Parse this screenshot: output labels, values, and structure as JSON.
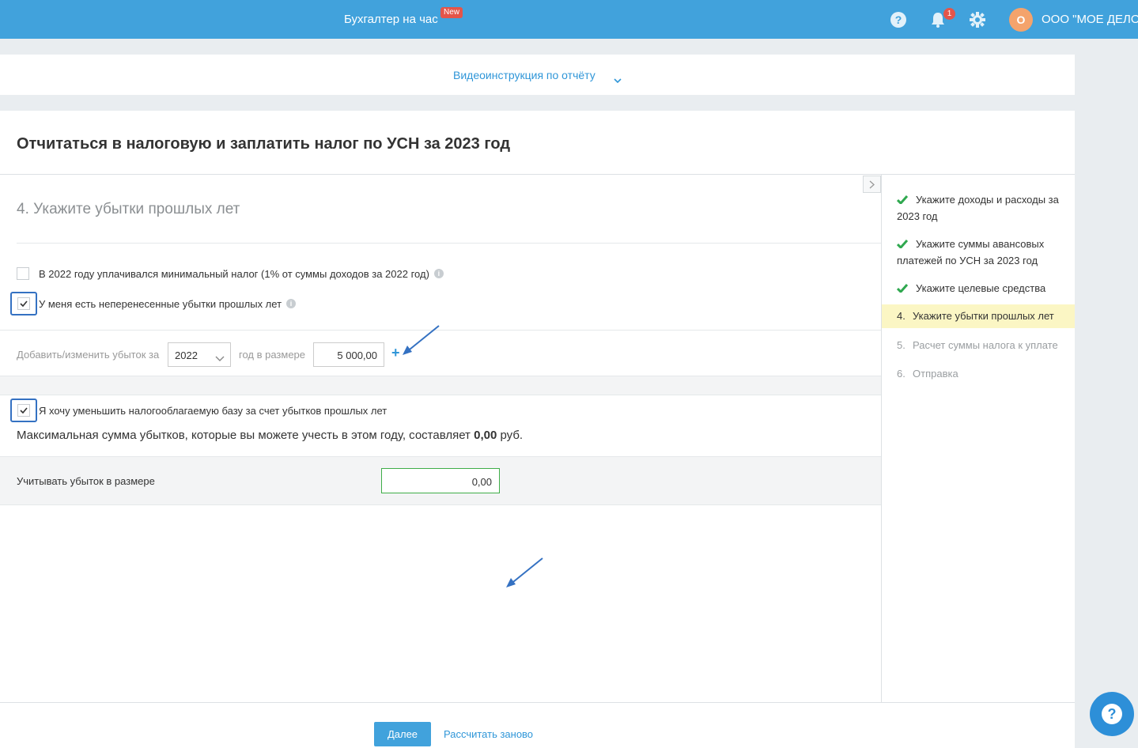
{
  "header": {
    "service_title": "Бухгалтер на час",
    "new_badge": "New",
    "notifications_count": "1",
    "avatar_letter": "О",
    "company_name": "ООО \"МОЕ ДЕЛО\""
  },
  "video": {
    "link_label": "Видеоинструкция по отчёту"
  },
  "page": {
    "title": "Отчитаться в налоговую и заплатить налог по УСН за 2023 год",
    "step_title": "4. Укажите убытки прошлых лет"
  },
  "form": {
    "min_tax_label": "В 2022 году уплачивался минимальный налог (1% от суммы доходов за 2022 год)",
    "min_tax_checked": false,
    "unused_losses_label": "У меня есть неперенесенные убытки прошлых лет",
    "unused_losses_checked": true,
    "add_loss_label": "Добавить/изменить убыток за",
    "year_value": "2022",
    "amount_label": "год в размере",
    "amount_value": "5 000,00",
    "add_button": "+",
    "reduce_base_label": "Я хочу уменьшить налогооблагаемую базу за счет убытков прошлых лет",
    "reduce_base_checked": true,
    "max_text_prefix": "Максимальная сумма убытков, которые вы можете учесть в этом году, составляет",
    "max_amount": "0,00",
    "max_text_suffix": "руб.",
    "consider_label": "Учитывать убыток в размере",
    "consider_value": "0,00"
  },
  "steps": [
    {
      "label": "Укажите доходы и расходы за 2023 год",
      "state": "done"
    },
    {
      "label": "Укажите суммы авансовых платежей по УСН за 2023 год",
      "state": "done"
    },
    {
      "label": "Укажите целевые средства",
      "state": "done"
    },
    {
      "num": "4.",
      "label": "Укажите убытки прошлых лет",
      "state": "active"
    },
    {
      "num": "5.",
      "label": "Расчет суммы налога к уплате",
      "state": "pending"
    },
    {
      "num": "6.",
      "label": "Отправка",
      "state": "pending"
    }
  ],
  "footer": {
    "next_button": "Далее",
    "recalc_link": "Рассчитать заново"
  },
  "colors": {
    "header_bg": "#41a2dc",
    "link": "#2f96d8",
    "check_green": "#2fa84f",
    "active_step_bg": "#fbf6c4",
    "highlight_frame": "#3471c2",
    "input_green": "#3fae49"
  }
}
